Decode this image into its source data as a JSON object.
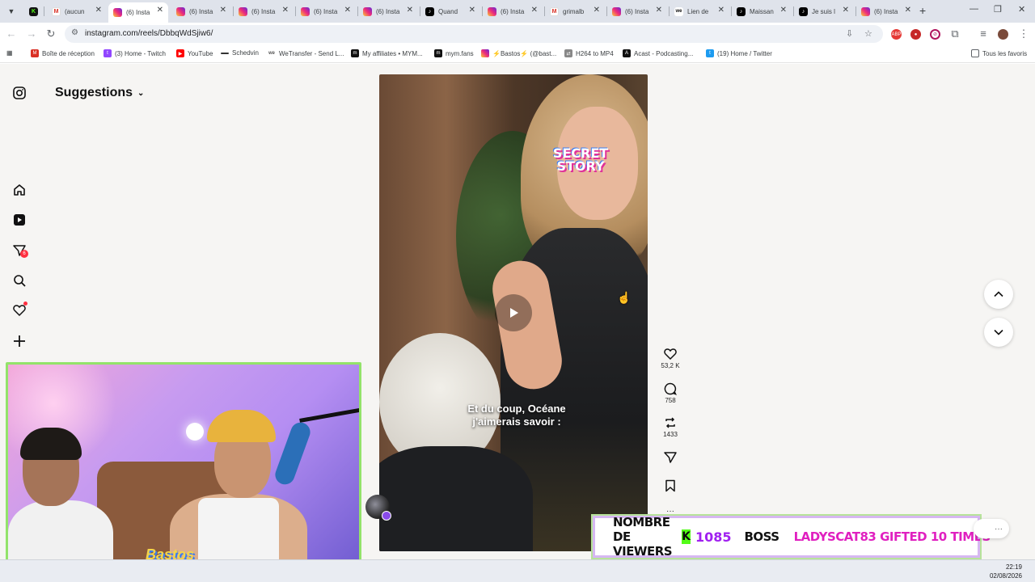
{
  "browser": {
    "tabs": [
      {
        "title": "",
        "favicon": "kick-icon",
        "active": false
      },
      {
        "title": "(aucun",
        "favicon": "gmail-icon",
        "active": false
      },
      {
        "title": "(6) Insta",
        "favicon": "instagram-icon",
        "active": true
      },
      {
        "title": "(6) Insta",
        "favicon": "instagram-icon",
        "active": false
      },
      {
        "title": "(6) Insta",
        "favicon": "instagram-icon",
        "active": false
      },
      {
        "title": "(6) Insta",
        "favicon": "instagram-icon",
        "active": false
      },
      {
        "title": "(6) Insta",
        "favicon": "instagram-icon",
        "active": false
      },
      {
        "title": "Quand",
        "favicon": "tiktok-icon",
        "active": false
      },
      {
        "title": "(6) Insta",
        "favicon": "instagram-icon",
        "active": false
      },
      {
        "title": "grimalb",
        "favicon": "gmail-icon",
        "active": false
      },
      {
        "title": "(6) Insta",
        "favicon": "instagram-icon",
        "active": false
      },
      {
        "title": "Lien de",
        "favicon": "wetransfer-icon",
        "active": false
      },
      {
        "title": "Maissan",
        "favicon": "tiktok-icon",
        "active": false
      },
      {
        "title": "Je suis l",
        "favicon": "tiktok-icon",
        "active": false
      },
      {
        "title": "(6) Insta",
        "favicon": "instagram-icon",
        "active": false
      }
    ],
    "url": "instagram.com/reels/DbbqWdSjiw6/",
    "bookmarks": [
      {
        "label": "Boîte de réception",
        "icon": "gmail-icon",
        "color": "#d93025"
      },
      {
        "label": "(3) Home - Twitch",
        "icon": "twitch-icon",
        "color": "#9146ff"
      },
      {
        "label": "YouTube",
        "icon": "youtube-icon",
        "color": "#ff0000"
      },
      {
        "label": "Schedvin",
        "icon": "dash-icon",
        "color": "#333333"
      },
      {
        "label": "WeTransfer - Send L...",
        "icon": "wetransfer-icon",
        "color": "#111111"
      },
      {
        "label": "My affiliates • MYM...",
        "icon": "mym-icon",
        "color": "#111111"
      },
      {
        "label": "mym.fans",
        "icon": "mym-icon",
        "color": "#111111"
      },
      {
        "label": "⚡Bastos⚡ (@bast...",
        "icon": "instagram-icon",
        "color": "#e1306c"
      },
      {
        "label": "H264 to MP4",
        "icon": "convert-icon",
        "color": "#888888"
      },
      {
        "label": "Acast - Podcasting...",
        "icon": "acast-icon",
        "color": "#111111"
      },
      {
        "label": "(19) Home / Twitter",
        "icon": "twitter-icon",
        "color": "#1d9bf0"
      }
    ],
    "all_bookmarks": "Tous les favoris"
  },
  "instagram": {
    "feed_title": "Suggestions",
    "notifications_badge": "6",
    "reel": {
      "logo_line1": "SECRET",
      "logo_line2": "STORY",
      "caption_line1": "Et du coup, Océane",
      "caption_line2": "j'aimerais savoir :"
    },
    "actions": {
      "likes": "53,2 K",
      "comments": "758",
      "reposts": "1433"
    }
  },
  "stream": {
    "webcam_sign": "Bastos",
    "viewers_label": "NOMBRE DE VIEWERS",
    "kick_letter": "K",
    "viewers_count": "1085",
    "boss_label": "BOSS",
    "gift_text": "LADYSCAT83 GIFTED 10 TIMES"
  },
  "taskbar": {
    "time": "22:19",
    "date": "02/08/2026"
  },
  "colors": {
    "kick_green": "#53fc18",
    "viewer_count_purple": "#a020f0",
    "gift_pink": "#e020c0",
    "webcam_border": "#93e36a"
  }
}
